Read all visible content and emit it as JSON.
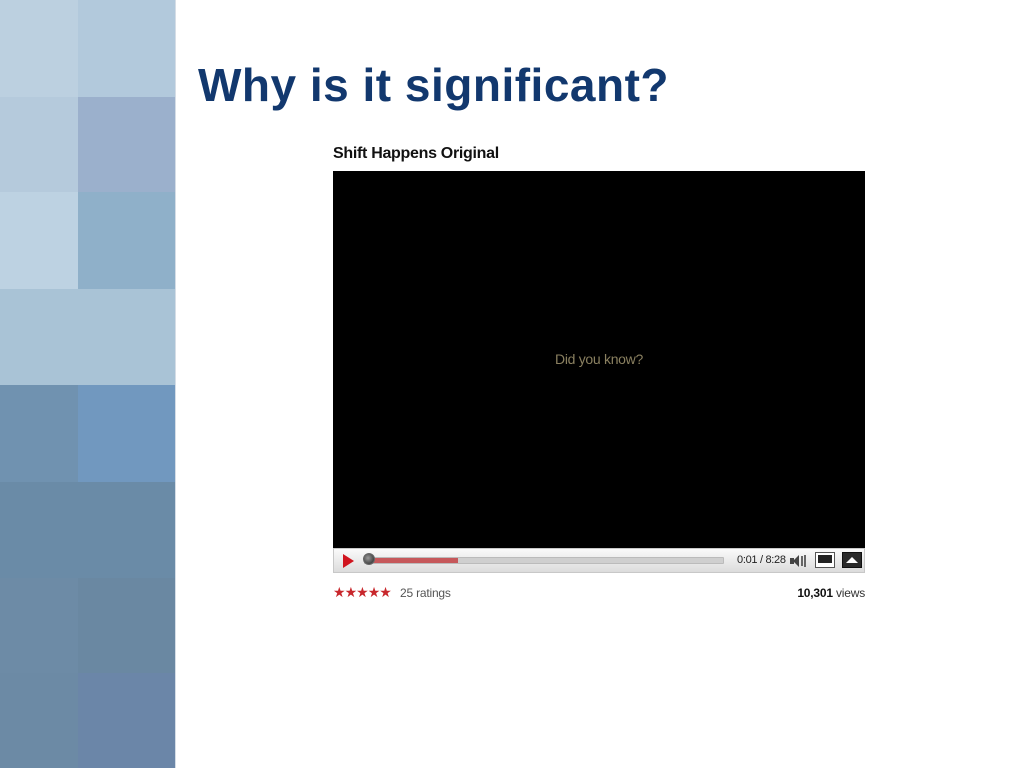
{
  "slide": {
    "title": "Why is it significant?"
  },
  "video": {
    "title": "Shift Happens Original",
    "caption": "Did you know?",
    "time_display": "0:01 / 8:28",
    "progress_fraction": 0.002,
    "loaded_fraction": 0.26,
    "rating_stars": 5,
    "ratings_text": "25 ratings",
    "views_count": "10,301",
    "views_label": "views"
  },
  "icons": {
    "play": "play-icon",
    "volume": "volume-icon",
    "popout": "popout-icon",
    "fullscreen": "fullscreen-icon",
    "star": "star-icon"
  },
  "colors": {
    "title": "#12386e",
    "play": "#d0141e",
    "stars": "#c8272c",
    "loaded_bar": "#c6585b",
    "caption": "#8a8060",
    "mosaic": [
      "#b7ccde",
      "#a9c2d6",
      "#9caec8",
      "#8eafc8",
      "#a7c2d6",
      "#6f8eae",
      "#7397bd",
      "#6a8aa8",
      "#6b88a4",
      "#6c86a6"
    ]
  }
}
